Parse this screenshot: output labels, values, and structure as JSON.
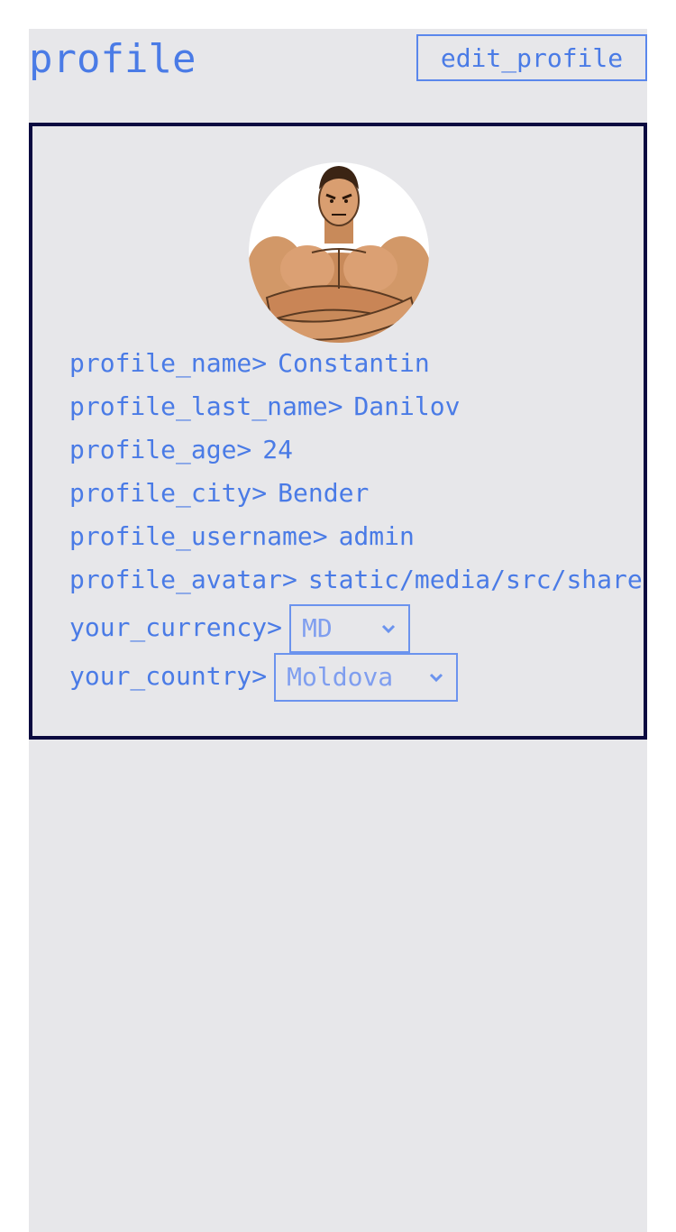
{
  "header": {
    "title": "profile",
    "edit_label": "edit_profile"
  },
  "profile": {
    "avatar_alt": "muscular man avatar",
    "fields": [
      {
        "key": "profile_name>",
        "value": "Constantin"
      },
      {
        "key": "profile_last_name>",
        "value": "Danilov"
      },
      {
        "key": "profile_age>",
        "value": "24"
      },
      {
        "key": "profile_city>",
        "value": "Bender"
      },
      {
        "key": "profile_username>",
        "value": "admin"
      },
      {
        "key": "profile_avatar>",
        "value": "static/media/src/shared/images/avatar.jpg"
      }
    ],
    "currency": {
      "label": "your_currency>",
      "selected": "MD"
    },
    "country": {
      "label": "your_country>",
      "selected": "Moldova"
    }
  },
  "colors": {
    "text": "#4a7be6",
    "panel_bg": "#e7e7ea",
    "card_border": "#0b0a40"
  },
  "icons": {
    "select_arrow": "chevron-down-icon"
  }
}
